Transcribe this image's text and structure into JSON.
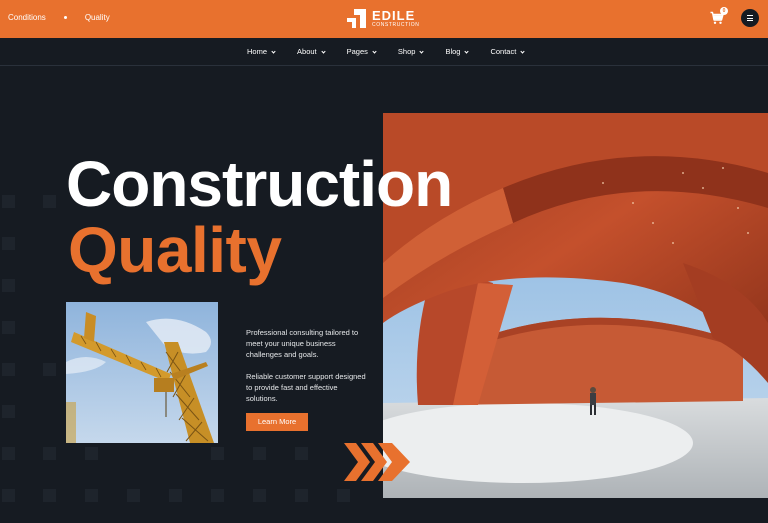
{
  "topbar": {
    "breadcrumbs": [
      "Conditions",
      "Quality"
    ],
    "logo_title": "EDILE",
    "logo_subtitle": "CONSTRUCTION",
    "cart_count": "0"
  },
  "nav": {
    "items": [
      {
        "label": "Home"
      },
      {
        "label": "About"
      },
      {
        "label": "Pages"
      },
      {
        "label": "Shop"
      },
      {
        "label": "Blog"
      },
      {
        "label": "Contact"
      }
    ]
  },
  "hero": {
    "title_line1": "Construction",
    "title_line2": "Quality",
    "paragraph1": "Professional consulting tailored to meet your unique business challenges and goals.",
    "paragraph2": "Reliable customer support designed to provide fast and effective solutions.",
    "cta_label": "Learn More"
  },
  "colors": {
    "accent": "#e8712e",
    "background": "#161b22"
  },
  "icons": [
    "cart-icon",
    "menu-icon",
    "logo-icon",
    "chevron-down-icon",
    "double-chevron-icon"
  ]
}
